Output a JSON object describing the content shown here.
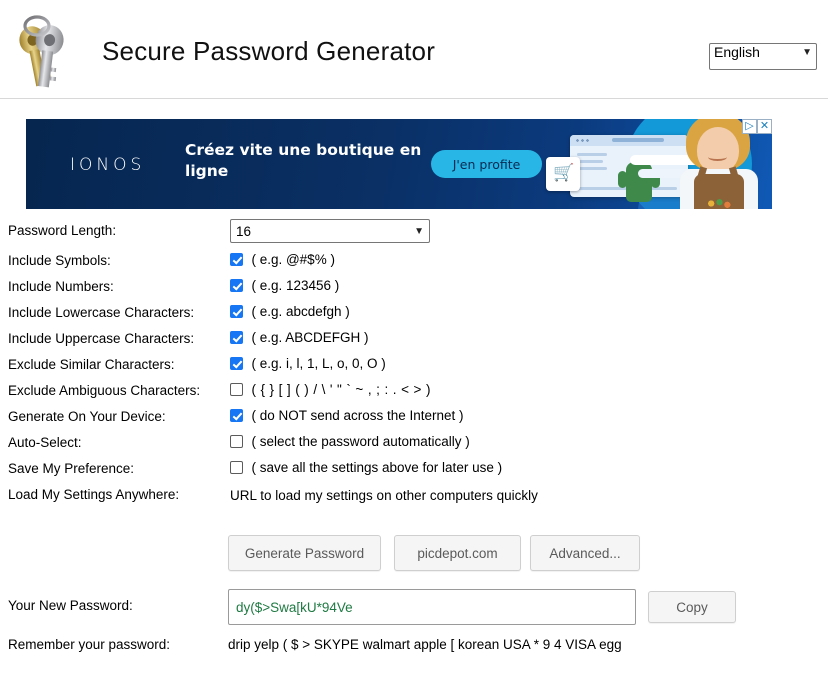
{
  "header": {
    "title": "Secure Password Generator",
    "logo_icon": "keys-icon",
    "language": {
      "selected": "English",
      "caret_icon": "chevron-down-icon"
    }
  },
  "ad": {
    "brand": "IONOS",
    "headline": "Créez vite une boutique en ligne",
    "cta_label": "J'en profite",
    "adchoices_icon": "adchoices-icon",
    "close_icon": "close-icon",
    "colors": {
      "background_dark": "#06264f",
      "background_light": "#0f59b5",
      "cta": "#27b6e6",
      "cta_text": "#0a2a52"
    }
  },
  "form": {
    "length": {
      "label": "Password Length:",
      "value": "16",
      "caret_icon": "chevron-down-icon"
    },
    "options": [
      {
        "label": "Include Symbols:",
        "checked": true,
        "hint": "( e.g. @#$% )"
      },
      {
        "label": "Include Numbers:",
        "checked": true,
        "hint": "( e.g. 123456 )"
      },
      {
        "label": "Include Lowercase Characters:",
        "checked": true,
        "hint": "( e.g. abcdefgh )"
      },
      {
        "label": "Include Uppercase Characters:",
        "checked": true,
        "hint": "( e.g. ABCDEFGH )"
      },
      {
        "label": "Exclude Similar Characters:",
        "checked": true,
        "hint": "( e.g. i, l, 1, L, o, 0, O )"
      },
      {
        "label": "Exclude Ambiguous Characters:",
        "checked": false,
        "hint": "( { } [ ] ( ) / \\ ' \" ` ~ , ; : . < > )"
      },
      {
        "label": "Generate On Your Device:",
        "checked": true,
        "hint": "( do NOT send across the Internet )"
      },
      {
        "label": "Auto-Select:",
        "checked": false,
        "hint": "( select the password automatically )"
      },
      {
        "label": "Save My Preference:",
        "checked": false,
        "hint": "( save all the settings above for later use )"
      }
    ],
    "load_settings": {
      "label": "Load My Settings Anywhere:",
      "text": "URL to load my settings on other computers quickly"
    }
  },
  "buttons": {
    "generate": "Generate Password",
    "site": "picdepot.com",
    "advanced": "Advanced..."
  },
  "result": {
    "label": "Your New Password:",
    "password": "dy($>Swa[kU*94Ve",
    "password_color": "#1f7a43",
    "copy_label": "Copy"
  },
  "mnemonic": {
    "label": "Remember your password:",
    "text": "drip yelp ( $ > SKYPE walmart apple [ korean USA * 9 4 VISA egg"
  }
}
